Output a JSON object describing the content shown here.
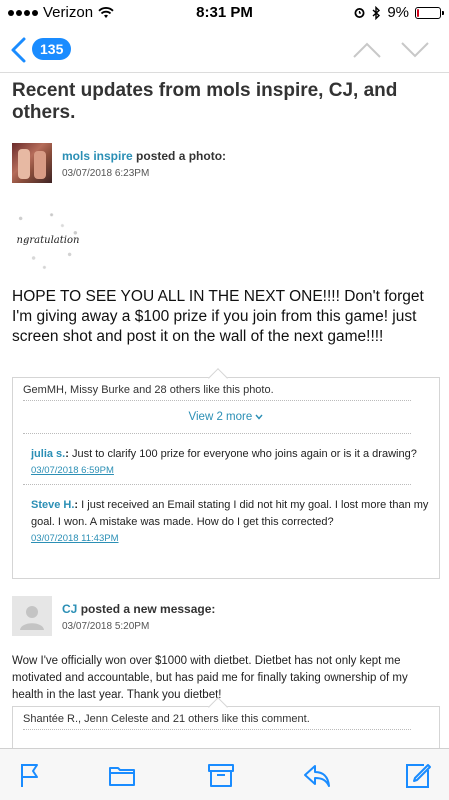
{
  "status_bar": {
    "carrier": "Verizon",
    "time": "8:31 PM",
    "battery": "9%",
    "battery_level": 0.09
  },
  "nav": {
    "back_count": "135"
  },
  "title": "Recent updates from mols inspire, CJ, and others.",
  "post1": {
    "author": "mols inspire",
    "action": "posted a photo:",
    "time": "03/07/2018 6:23PM",
    "image_text": "ngratulation",
    "body": "HOPE TO SEE YOU ALL IN THE NEXT ONE!!!! Don't forget I'm giving away a $100 prize if you join from this game! just screen shot and post it on the wall of the next game!!!!",
    "likes": "GemMH, Missy Burke and 28 others like this photo.",
    "view_more": "View 2 more",
    "comments": [
      {
        "author": "julia s.",
        "text": " Just to clarify 100 prize for everyone who joins again or is it a drawing?",
        "time": "03/07/2018 6:59PM"
      },
      {
        "author": "Steve H.",
        "text": " I just received an Email stating I did not hit my goal. I lost more than my goal. I won. A mistake was made. How do I get this corrected?",
        "time": "03/07/2018 11:43PM"
      }
    ]
  },
  "post2": {
    "author": "CJ",
    "action": "posted a new message:",
    "time": "03/07/2018 5:20PM",
    "body": "Wow I've officially won over $1000 with dietbet. Dietbet has not only kept me motivated and accountable, but has paid me for finally taking ownership of my health in the last year. Thank you dietbet!",
    "likes": "Shantée R., Jenn Celeste and 21 others like this comment."
  },
  "colors": {
    "accent": "#1a8cff",
    "link": "#2b8fb5"
  },
  "tab_bar": {
    "icons": [
      "flag-icon",
      "folder-icon",
      "archive-icon",
      "reply-icon",
      "compose-icon"
    ]
  }
}
